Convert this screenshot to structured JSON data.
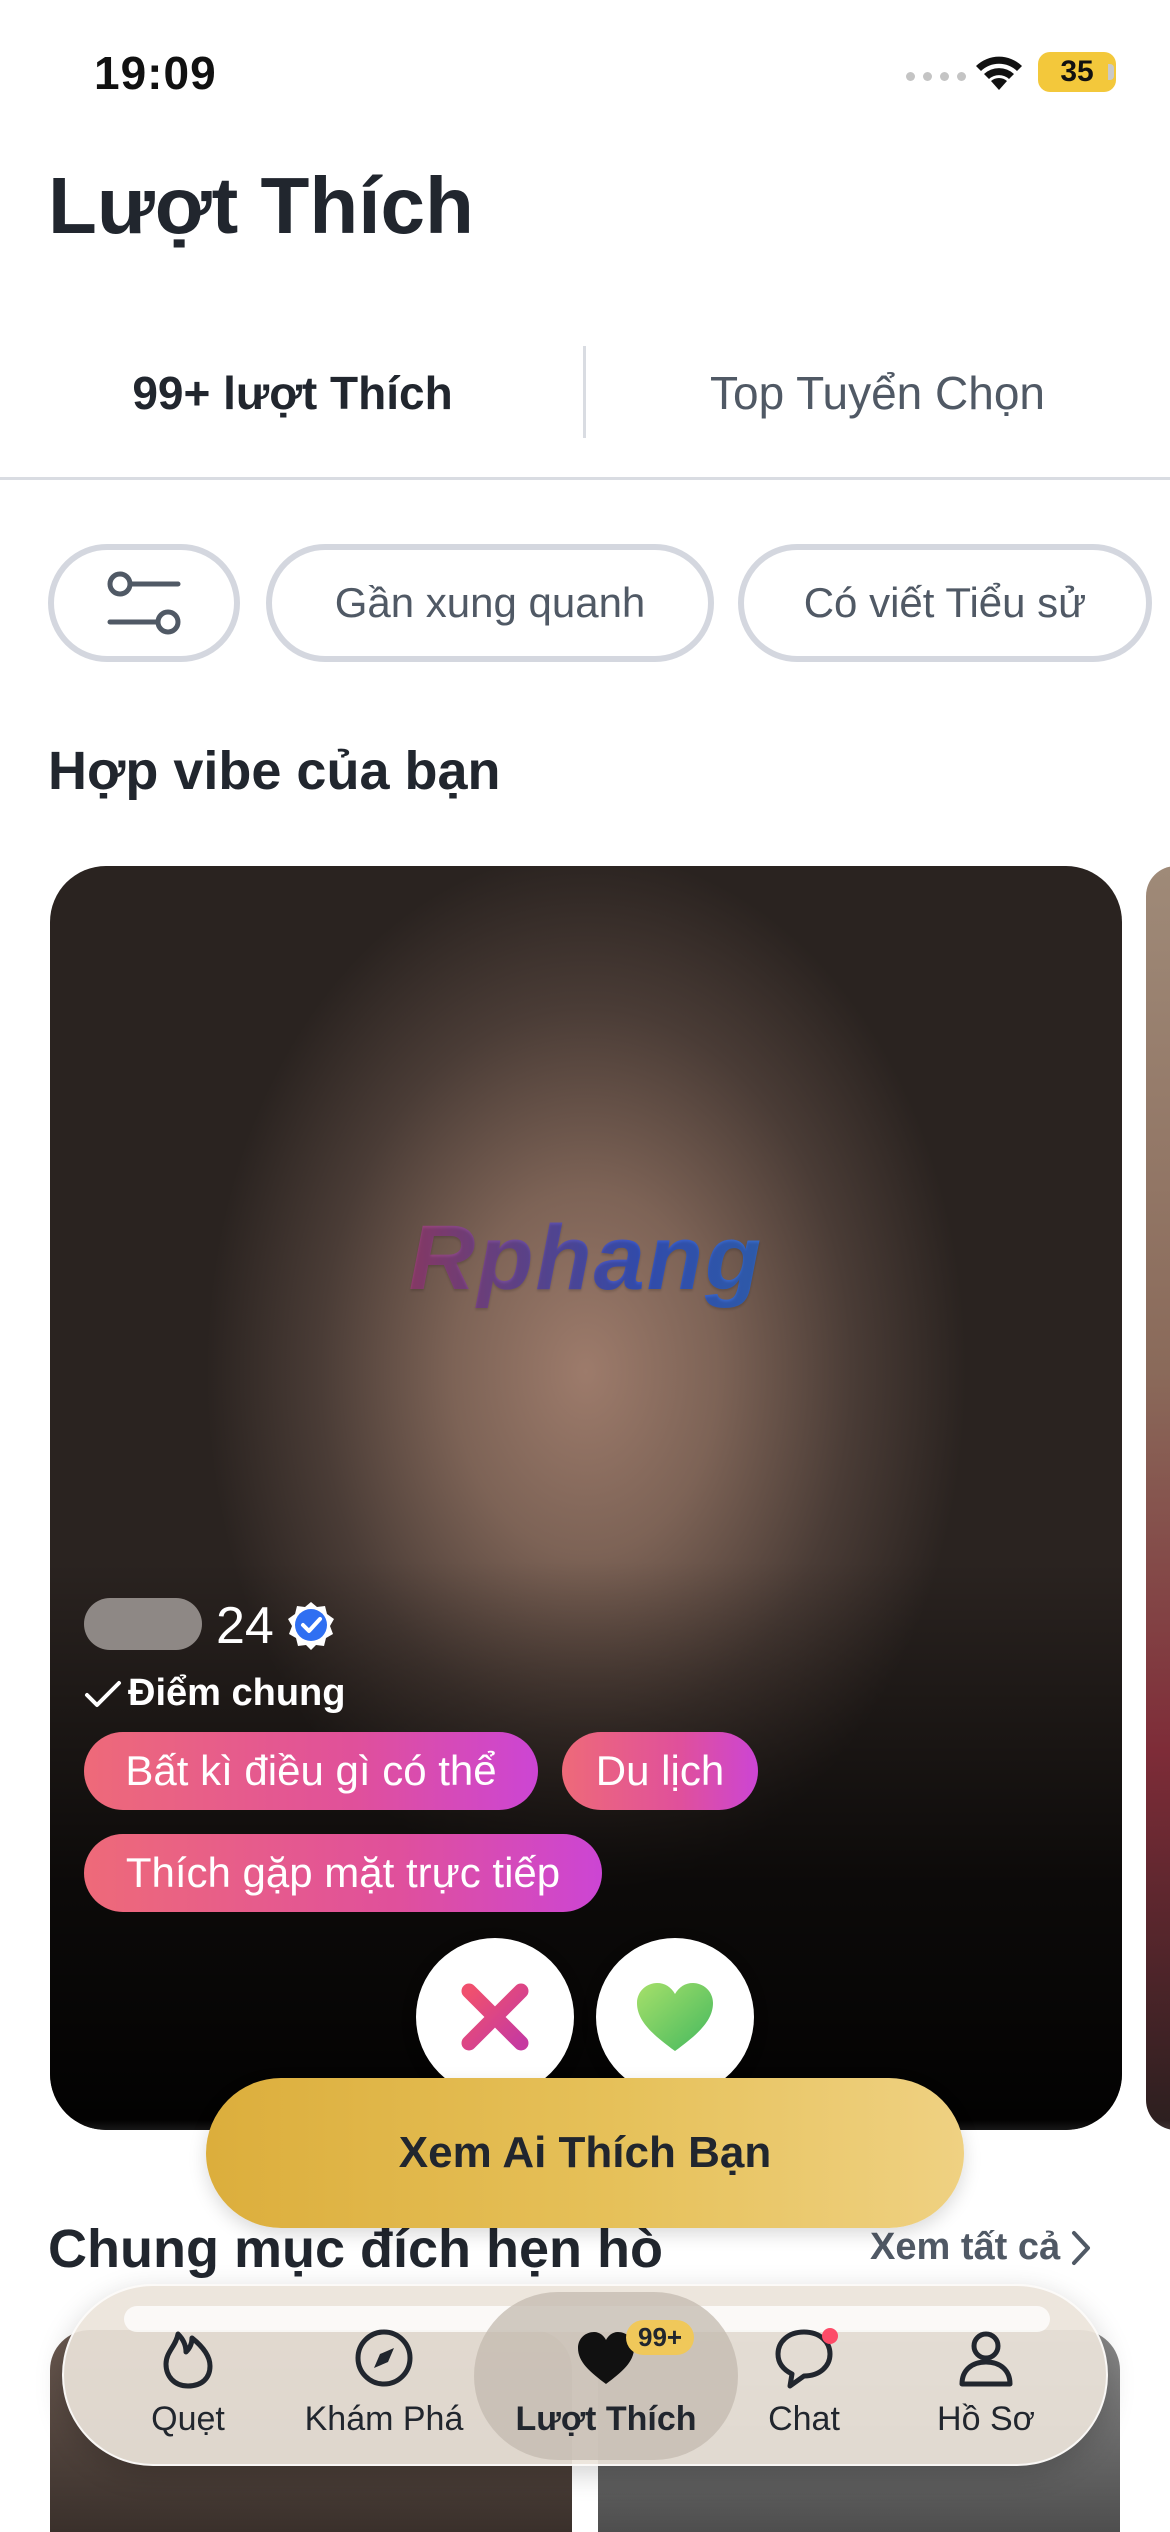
{
  "status_bar": {
    "time": "19:09",
    "battery": "35"
  },
  "page": {
    "title": "Lượt Thích"
  },
  "tabs": [
    {
      "label": "99+ lượt Thích",
      "active": true
    },
    {
      "label": "Top Tuyển Chọn",
      "active": false
    }
  ],
  "filters": {
    "settings_icon": "sliders-icon",
    "chips": [
      "Gần xung quanh",
      "Có viết Tiểu sử"
    ]
  },
  "section": {
    "title": "Hợp vibe của bạn"
  },
  "card": {
    "watermark": "Rphang",
    "age": "24",
    "common_label": "Điểm chung",
    "tags": [
      "Bất kì điều gì có thể",
      "Du lịch",
      "Thích gặp mặt trực tiếp"
    ]
  },
  "cta": {
    "label": "Xem Ai Thích Bạn"
  },
  "section2": {
    "title": "Chung mục đích hẹn hò",
    "see_all": "Xem tất cả"
  },
  "nav": {
    "items": [
      {
        "label": "Quẹt",
        "icon": "flame-icon"
      },
      {
        "label": "Khám Phá",
        "icon": "compass-icon"
      },
      {
        "label": "Lượt Thích",
        "icon": "heart-icon",
        "badge": "99+",
        "active": true
      },
      {
        "label": "Chat",
        "icon": "chat-icon"
      },
      {
        "label": "Hồ Sơ",
        "icon": "profile-icon"
      }
    ]
  },
  "colors": {
    "accent_gold": "#e6c15a",
    "tag_pink": "#e0509b",
    "text": "#21262e"
  }
}
